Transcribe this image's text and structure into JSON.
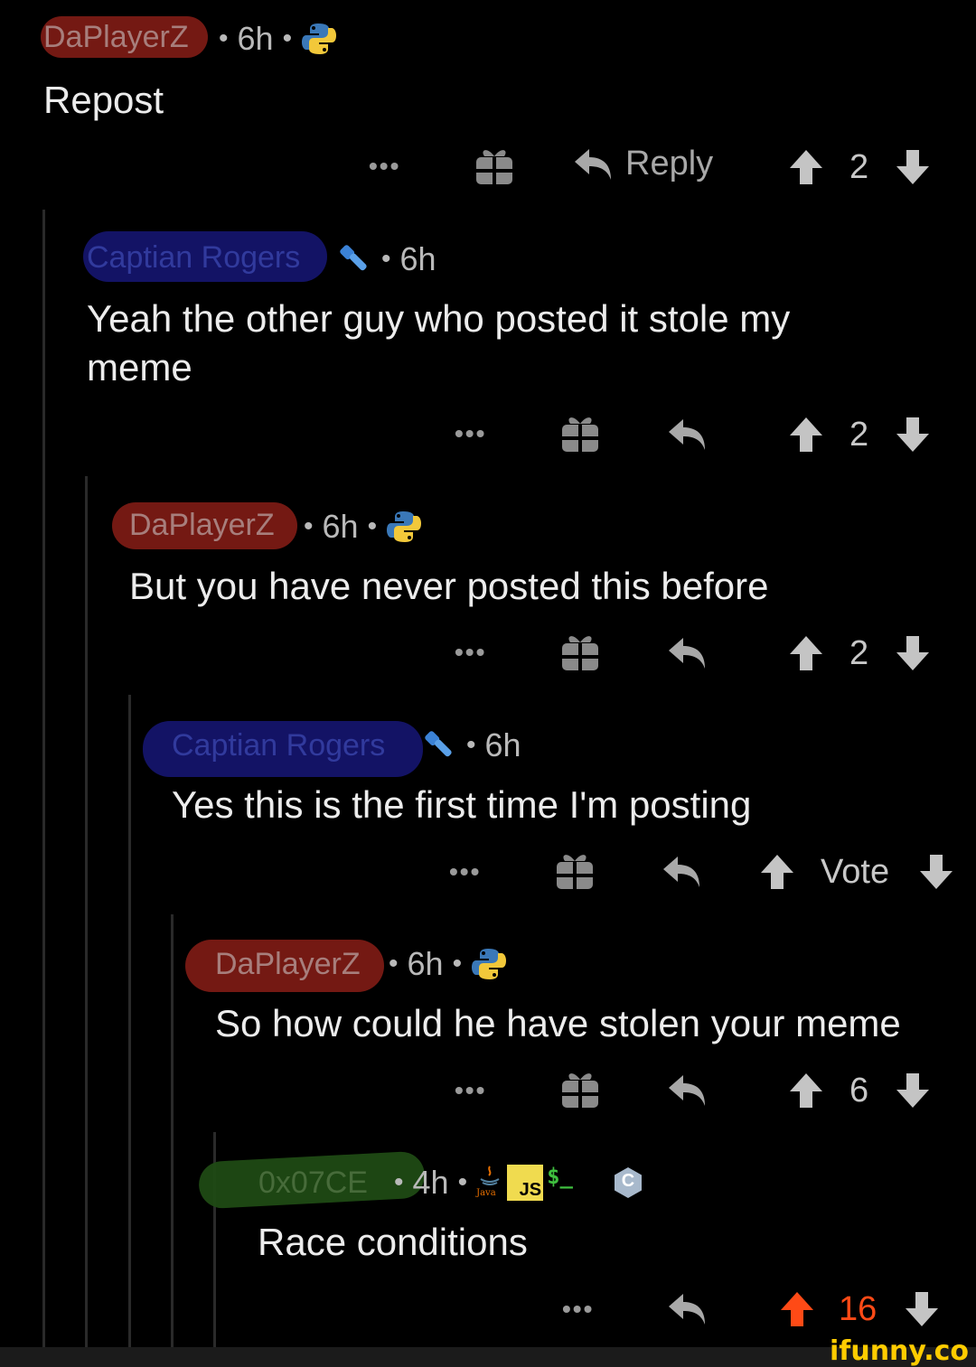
{
  "comments": [
    {
      "username": "DaPlayerZ",
      "time": "6h",
      "badge": "python-icon",
      "text": "Repost",
      "reply_label": "Reply",
      "score": "2"
    },
    {
      "username": "Captian Rogers",
      "time": "6h",
      "badge": "flashlight-icon",
      "text": "Yeah the other guy who posted it stole my meme",
      "score": "2"
    },
    {
      "username": "DaPlayerZ",
      "time": "6h",
      "badge": "python-icon",
      "text": "But you have never posted this before",
      "score": "2"
    },
    {
      "username": "Captian Rogers",
      "time": "6h",
      "badge": "flashlight-icon",
      "text": "Yes this is the first time I'm posting",
      "score": "Vote"
    },
    {
      "username": "DaPlayerZ",
      "time": "6h",
      "badge": "python-icon",
      "text": "So how could he have stolen your meme",
      "score": "6"
    },
    {
      "username": "0x07CE",
      "time": "4h",
      "badges": [
        "java-icon",
        "js-icon",
        "terminal-icon",
        "c-icon"
      ],
      "java_label": "Java",
      "js_label": "JS",
      "terminal_label": "$_",
      "c_label": "C",
      "text": "Race conditions",
      "score": "16"
    }
  ],
  "ellipsis": "•••",
  "separator": "•",
  "watermark": "ifunny.co",
  "colors": {
    "background": "#000000",
    "upvoted": "#ff4a16",
    "text": "#ececec",
    "muted": "#b9b9b9"
  }
}
